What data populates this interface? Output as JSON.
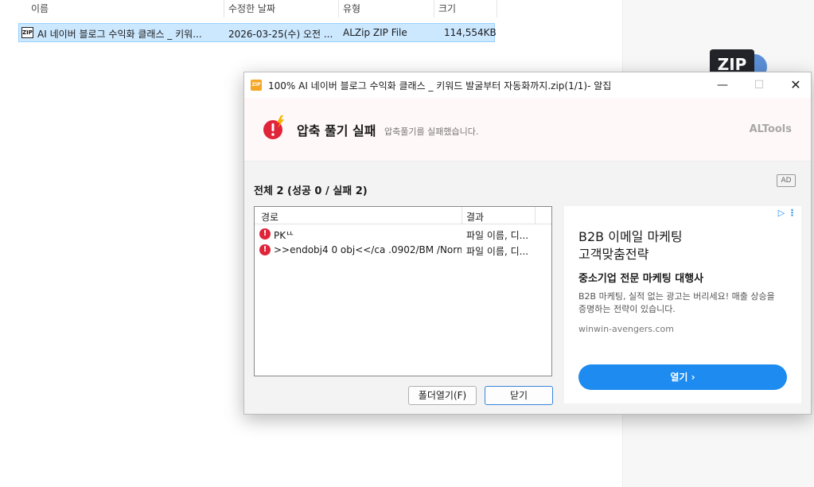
{
  "explorer": {
    "columns": {
      "name": "이름",
      "modified": "수정한 날짜",
      "type": "유형",
      "size": "크기"
    },
    "file": {
      "icon_label": "ZIP",
      "name": "AI 네이버 블로그 수익화 클래스 _ 키워...",
      "modified": "2026-03-25(수) 오전 ...",
      "type": "ALZip ZIP File",
      "size": "114,554KB"
    },
    "preview_icon_label": "ZIP"
  },
  "dialog": {
    "app_icon_label": "ZIP",
    "title": "100% AI 네이버 블로그 수익화 클래스 _ 키워드 발굴부터 자동화까지.zip(1/1)- 알집",
    "window_buttons": {
      "minimize": "—",
      "maximize": "☐",
      "close": "✕"
    },
    "banner": {
      "title": "압축 풀기 실패",
      "subtitle": "압축풀기를 실패했습니다.",
      "brand": "ALTools"
    },
    "summary": "전체 2 (성공 0 / 실패 2)",
    "ad_badge": "AD",
    "list": {
      "headers": {
        "path": "경로",
        "result": "결과"
      },
      "rows": [
        {
          "icon": "error-icon",
          "path": "PKᄔ",
          "result": "파일 이름, 디..."
        },
        {
          "icon": "error-icon",
          "path": ">>endobj4 0 obj<</ca .0902/BM /Norm...",
          "result": "파일 이름, 디..."
        }
      ]
    },
    "buttons": {
      "open_folder": "폴더열기(F)",
      "close": "닫기"
    },
    "ad": {
      "choices": "▷ ⋮",
      "headline_line1": "B2B 이메일 마케팅",
      "headline_line2": "고객맞춤전략",
      "subheadline": "중소기업 전문 마케팅 대행사",
      "description": "B2B 마케팅, 실적 없는 광고는 버리세요! 매출 상승을 증명하는 전략이 있습니다.",
      "url": "winwin-avengers.com",
      "cta": "열기 ›"
    }
  },
  "colors": {
    "accent": "#1d8bf0",
    "error": "#e0243a",
    "selection": "#cce8ff"
  }
}
